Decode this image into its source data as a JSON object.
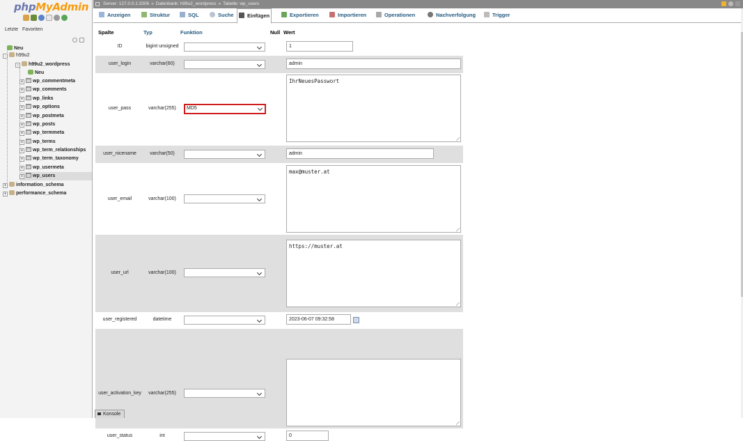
{
  "logo": {
    "part_a": "php",
    "part_b": "MyAdmin"
  },
  "nav": {
    "tabs": [
      "Letzte",
      "Favoriten"
    ],
    "tree": [
      {
        "label": "Neu"
      },
      {
        "label": "h99u2"
      },
      {
        "label": "h99u2_wordpress"
      },
      {
        "label": "Neu"
      },
      {
        "label": "wp_commentmeta"
      },
      {
        "label": "wp_comments"
      },
      {
        "label": "wp_links"
      },
      {
        "label": "wp_options"
      },
      {
        "label": "wp_postmeta"
      },
      {
        "label": "wp_posts"
      },
      {
        "label": "wp_termmeta"
      },
      {
        "label": "wp_terms"
      },
      {
        "label": "wp_term_relationships"
      },
      {
        "label": "wp_term_taxonomy"
      },
      {
        "label": "wp_usermeta"
      },
      {
        "label": "wp_users"
      },
      {
        "label": "information_schema"
      },
      {
        "label": "performance_schema"
      }
    ]
  },
  "breadcrumb": {
    "server": "Server: 127.0.0.1:3306",
    "database": "Datenbank: h99u2_wordpress",
    "table": "Tabelle: wp_users",
    "sep": "»"
  },
  "tabs": [
    "Anzeigen",
    "Struktur",
    "SQL",
    "Suche",
    "Einfügen",
    "Exportieren",
    "Importieren",
    "Operationen",
    "Nachverfolgung",
    "Trigger"
  ],
  "active_tab": "Einfügen",
  "table_header": {
    "column": "Spalte",
    "type": "Typ",
    "function": "Funktion",
    "null": "Null",
    "value": "Wert"
  },
  "rows": [
    {
      "name": "ID",
      "type": "bigint unsigned",
      "function": "",
      "value": "1"
    },
    {
      "name": "user_login",
      "type": "varchar(60)",
      "function": "",
      "value": "admin"
    },
    {
      "name": "user_pass",
      "type": "varchar(255)",
      "function": "MD5",
      "value": "IhrNeuesPasswort"
    },
    {
      "name": "user_nicename",
      "type": "varchar(50)",
      "function": "",
      "value": "admin"
    },
    {
      "name": "user_email",
      "type": "varchar(100)",
      "function": "",
      "value": "max@muster.at"
    },
    {
      "name": "user_url",
      "type": "varchar(100)",
      "function": "",
      "value": "https://muster.at"
    },
    {
      "name": "user_registered",
      "type": "datetime",
      "function": "",
      "value": "2023-06-07 09:32:58"
    },
    {
      "name": "user_activation_key",
      "type": "varchar(255)",
      "function": "",
      "value": ""
    },
    {
      "name": "user_status",
      "type": "int",
      "function": "",
      "value": "0"
    }
  ],
  "console": {
    "label": "Konsole"
  },
  "colors": {
    "logo_blue": "#6c78af",
    "logo_orange": "#f89c0e",
    "link": "#235a81",
    "highlight": "#d01b1b",
    "row_even": "#dfdfdf"
  }
}
